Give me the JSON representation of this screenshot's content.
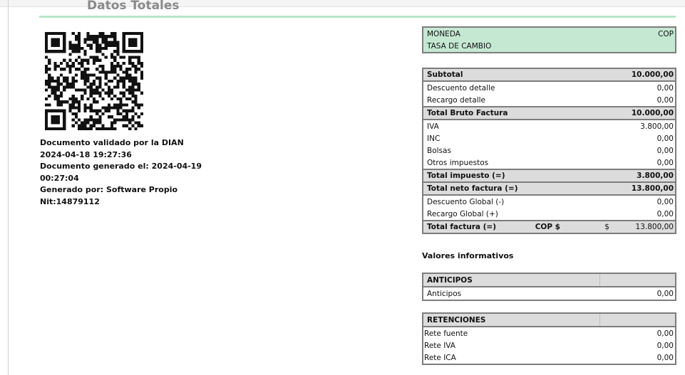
{
  "section_title": "Datos Totales",
  "doc_info": {
    "validated": "Documento validado por la DIAN 2024-04-18 19:27:36",
    "generated": "Documento generado el: 2024-04-19 00:27:04",
    "generated_by": "Generado por: Software Propio",
    "nit": "Nit:14879112"
  },
  "currency": {
    "moneda_label": "MONEDA",
    "moneda_value": "COP",
    "tasa_label": "TASA DE CAMBIO",
    "tasa_value": ""
  },
  "totals": {
    "subtotal_label": "Subtotal",
    "subtotal_value": "10.000,00",
    "descuento_detalle_label": "Descuento detalle",
    "descuento_detalle_value": "0,00",
    "recargo_detalle_label": "Recargo detalle",
    "recargo_detalle_value": "0,00",
    "bruto_label": "Total Bruto Factura",
    "bruto_value": "10.000,00",
    "iva_label": "IVA",
    "iva_value": "3.800,00",
    "inc_label": "INC",
    "inc_value": "0,00",
    "bolsas_label": "Bolsas",
    "bolsas_value": "0,00",
    "otros_label": "Otros impuestos",
    "otros_value": "0,00",
    "impuesto_label": "Total impuesto (=)",
    "impuesto_value": "3.800,00",
    "neto_label": "Total neto factura (=)",
    "neto_value": "13.800,00",
    "desc_global_label": "Descuento Global (-)",
    "desc_global_value": "0,00",
    "rec_global_label": "Recargo Global (+)",
    "rec_global_value": "0,00",
    "total_label": "Total factura (=)",
    "total_currency": "COP $",
    "total_symbol": "$",
    "total_value": "13.800,00"
  },
  "informativos_title": "Valores informativos",
  "anticipos": {
    "header": "ANTICIPOS",
    "label": "Anticipos",
    "value": "0,00"
  },
  "retenciones": {
    "header": "RETENCIONES",
    "rows": [
      {
        "label": "Rete fuente",
        "value": "0,00"
      },
      {
        "label": "Rete IVA",
        "value": "0,00"
      },
      {
        "label": "Rete ICA",
        "value": "0,00"
      }
    ]
  },
  "colors": {
    "green_accent": "#b5e7c7",
    "currency_bg": "#c5e8d3",
    "header_gray": "#dcdcdc",
    "border_gray": "#7d7d7d"
  },
  "icons": {
    "qr": "qr-code"
  }
}
